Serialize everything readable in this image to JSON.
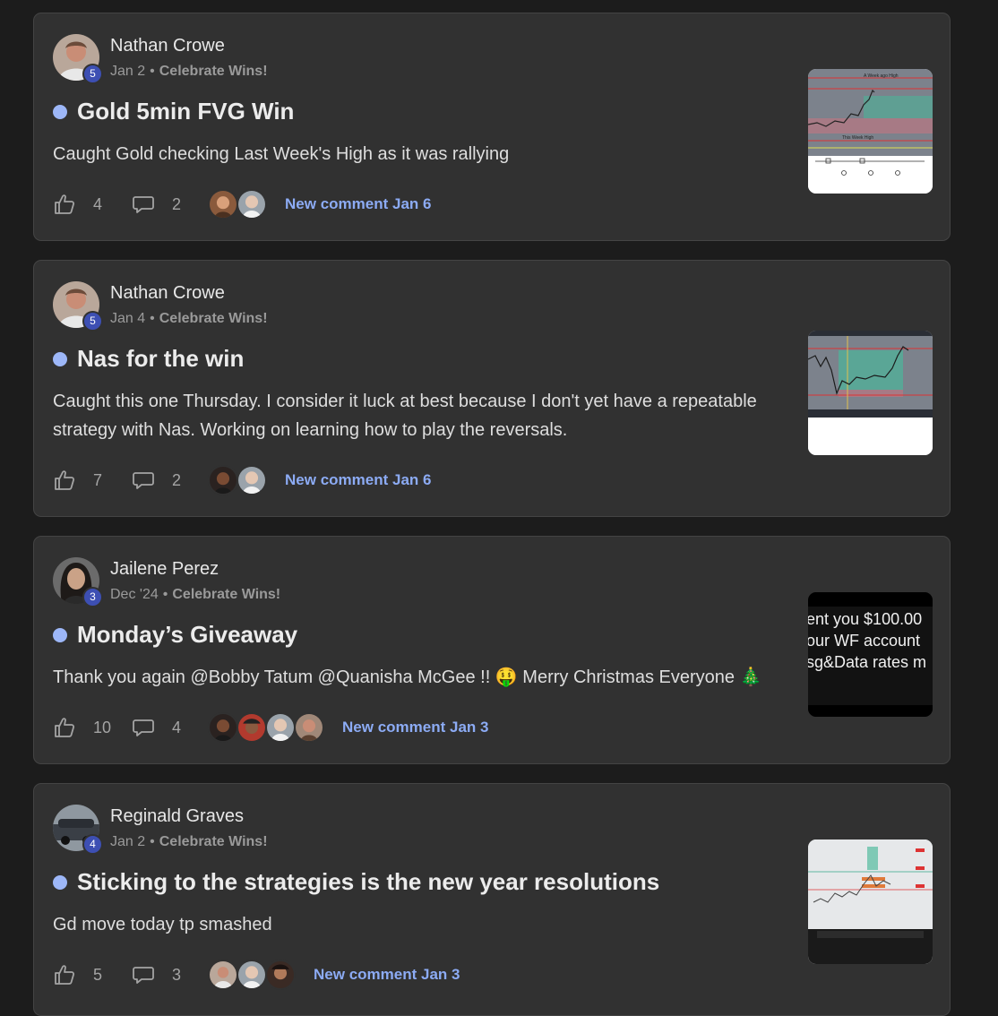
{
  "posts": [
    {
      "author": "Nathan Crowe",
      "level": "5",
      "date": "Jan 2",
      "separator": "•",
      "category": "Celebrate Wins!",
      "title": "Gold 5min FVG Win",
      "body": "Caught Gold checking Last Week's High as it was rallying",
      "likes": "4",
      "comments": "2",
      "new_comment": "New comment Jan 6",
      "thumbnail_labels": [
        "A Week ago High",
        "This Week High"
      ]
    },
    {
      "author": "Nathan Crowe",
      "level": "5",
      "date": "Jan 4",
      "separator": "•",
      "category": "Celebrate Wins!",
      "title": "Nas for the win",
      "body": "Caught this one Thursday. I consider it luck at best because I don't yet have a repeatable strategy with Nas. Working on learning how to play the reversals.",
      "likes": "7",
      "comments": "2",
      "new_comment": "New comment Jan 6"
    },
    {
      "author": "Jailene Perez",
      "level": "3",
      "date": "Dec '24",
      "separator": "•",
      "category": "Celebrate Wins!",
      "title": "Monday’s Giveaway",
      "body": "Thank you again @Bobby Tatum @Quanisha McGee !! 🤑 Merry Christmas Everyone 🎄",
      "likes": "10",
      "comments": "4",
      "new_comment": "New comment Jan 3",
      "thumbnail_lines": [
        "ent you $100.00",
        "our WF account",
        "sg&Data rates m"
      ]
    },
    {
      "author": "Reginald Graves",
      "level": "4",
      "date": "Jan 2",
      "separator": "•",
      "category": "Celebrate Wins!",
      "title": "Sticking to the strategies is the new year resolutions",
      "body": "Gd move today tp smashed",
      "likes": "5",
      "comments": "3",
      "new_comment": "New comment Jan 3"
    }
  ],
  "icons": {
    "like": "thumbs-up-icon",
    "comment": "comment-bubble-icon"
  },
  "colors": {
    "accent_link": "#8cabf4",
    "unread_dot": "#9db7f8",
    "level_badge": "#3d4fb3",
    "card_bg": "#313131",
    "page_bg": "#1c1c1c"
  }
}
